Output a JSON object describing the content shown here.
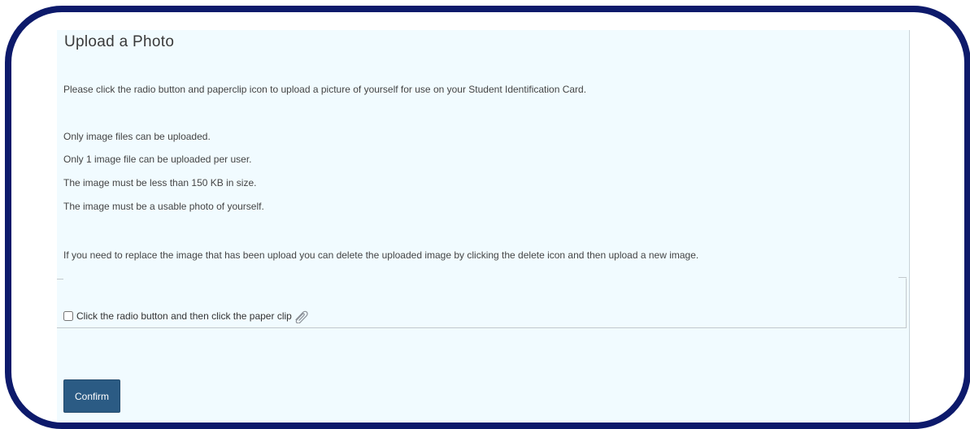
{
  "page": {
    "title": "Upload a Photo",
    "intro": "Please click the radio button and paperclip icon to upload a picture of yourself for use on your Student Identification Card.",
    "rules": [
      "Only image files can be uploaded.",
      "Only 1 image file can be uploaded per user.",
      "The image must be less than 150 KB in size.",
      "The image must be a usable photo of yourself."
    ],
    "replace_note": "If you need to replace the image that has been upload you can delete the uploaded image by clicking the delete icon and then upload a new image."
  },
  "upload": {
    "checkbox_label": "Click the radio button and then click the paper clip",
    "checked": false,
    "attach_icon": "paperclip-icon"
  },
  "actions": {
    "confirm_label": "Confirm"
  },
  "colors": {
    "frame_border": "#0d1a6b",
    "panel_background": "#f1fbff",
    "confirm_button": "#2b5b84"
  }
}
